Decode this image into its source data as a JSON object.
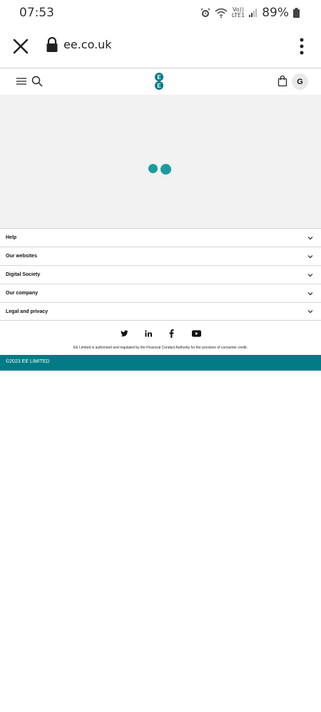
{
  "status_bar": {
    "time": "07:53",
    "network_label": "Vo))\nLTE1",
    "battery_percent": "89%"
  },
  "browser": {
    "url": "ee.co.uk"
  },
  "site_header": {
    "logo_letters": [
      "E",
      "E"
    ],
    "avatar_initial": "G",
    "brand_color": "#007b85"
  },
  "footer": {
    "items": [
      {
        "label": "Help"
      },
      {
        "label": "Our websites"
      },
      {
        "label": "Digital Society"
      },
      {
        "label": "Our company"
      },
      {
        "label": "Legal and privacy"
      }
    ],
    "social": [
      "twitter-icon",
      "linkedin-icon",
      "facebook-icon",
      "youtube-icon"
    ],
    "legal_note": "EE Limited is authorised and regulated by the Financial Conduct Authority for the provision of consumer credit.",
    "copyright": "©2023 EE LIMITED"
  }
}
